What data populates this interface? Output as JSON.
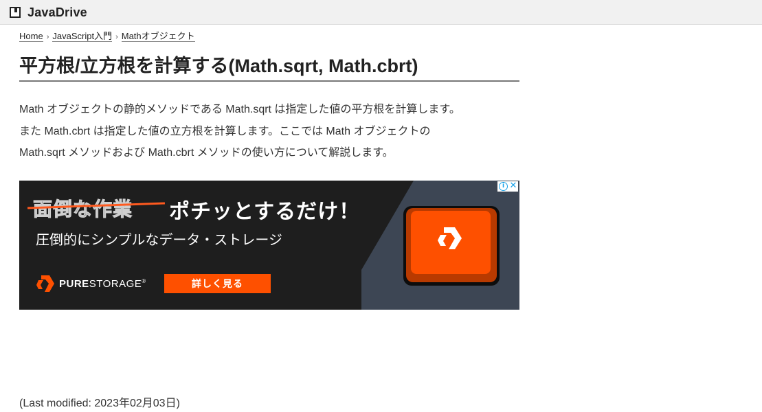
{
  "header": {
    "site_name": "JavaDrive",
    "logo_icon": "book-icon"
  },
  "breadcrumb": {
    "items": [
      "Home",
      "JavaScript入門",
      "Mathオブジェクト"
    ],
    "separator": "›"
  },
  "article": {
    "title": "平方根/立方根を計算する(Math.sqrt, Math.cbrt)",
    "intro_lines": [
      "Math オブジェクトの静的メソッドである Math.sqrt は指定した値の平方根を計算します。",
      "また Math.cbrt は指定した値の立方根を計算します。ここでは Math オブジェクトの",
      "Math.sqrt メソッドおよび Math.cbrt メソッドの使い方について解説します。"
    ],
    "last_modified": "(Last modified: 2023年02月03日)"
  },
  "ad": {
    "struck_text": "面倒な作業",
    "headline": "ポチッとするだけ！",
    "subtext": "圧倒的にシンプルなデータ・ストレージ",
    "brand_bold": "PURE",
    "brand_rest": "STORAGE",
    "brand_mark": "®",
    "cta_label": "詳しく見る",
    "info_icon": "info-icon",
    "close_icon": "close-icon",
    "colors": {
      "background": "#1e1e1e",
      "accent": "#fe5000",
      "panel": "#3d4654"
    }
  }
}
